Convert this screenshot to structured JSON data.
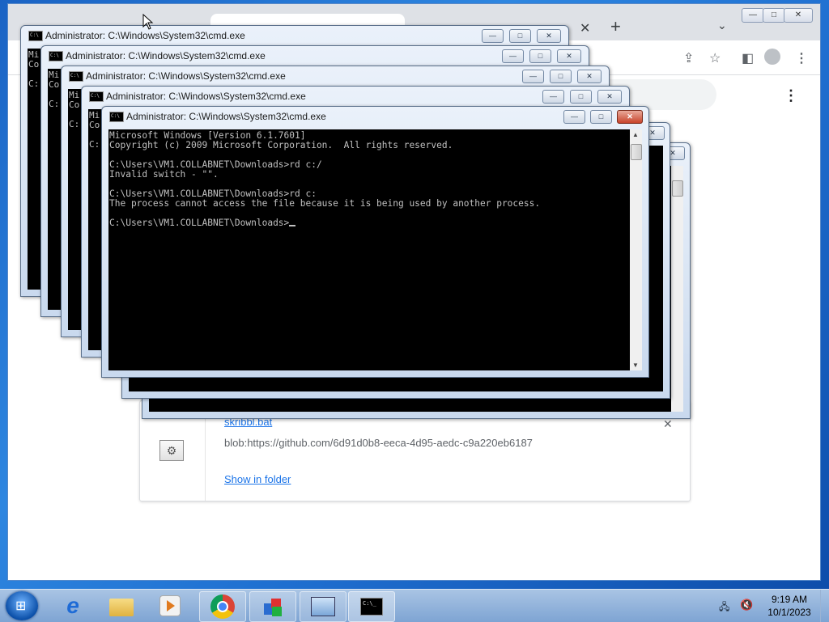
{
  "browser": {
    "tab_close": "✕",
    "new_tab": "+",
    "tab_dropdown": "⌄",
    "minimize": "—",
    "maximize": "□",
    "close": "✕"
  },
  "download": {
    "file_name": "skribbl.bat",
    "url": "blob:https://github.com/6d91d0b8-eeca-4d95-aedc-c9a220eb6187",
    "show_in_folder": "Show in folder",
    "close": "✕"
  },
  "cmd": {
    "title": "Administrator: C:\\Windows\\System32\\cmd.exe",
    "peek_text": "Mi\nCo\n\nC:",
    "lines": [
      "Microsoft Windows [Version 6.1.7601]",
      "Copyright (c) 2009 Microsoft Corporation.  All rights reserved.",
      "",
      "C:\\Users\\VM1.COLLABNET\\Downloads>rd c:/",
      "Invalid switch - \"\".",
      "",
      "C:\\Users\\VM1.COLLABNET\\Downloads>rd c:",
      "The process cannot access the file because it is being used by another process.",
      "",
      "C:\\Users\\VM1.COLLABNET\\Downloads>"
    ],
    "btn_min": "—",
    "btn_max": "□",
    "btn_close": "✕",
    "icon_text": "C:\\"
  },
  "taskbar": {
    "clock_time": "9:19 AM",
    "clock_date": "10/1/2023",
    "cmd_icon_text": "C:\\_"
  }
}
